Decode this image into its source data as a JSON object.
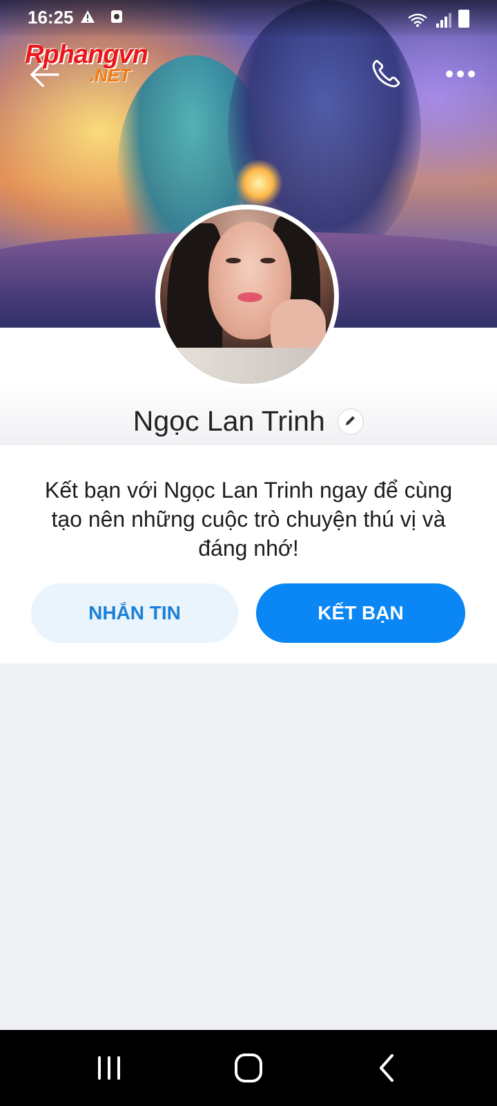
{
  "status_bar": {
    "time": "16:25",
    "left_icons": [
      "warning-icon",
      "media-icon"
    ],
    "right_icons": [
      "wifi-icon",
      "signal-icon",
      "battery-icon"
    ]
  },
  "watermark": {
    "brand": "Rphangvn",
    "suffix": ".NET"
  },
  "header": {
    "back_icon": "back-arrow-icon",
    "call_icon": "phone-icon",
    "more_icon": "more-dots-icon"
  },
  "profile": {
    "name": "Ngọc Lan Trinh",
    "edit_icon": "pencil-icon",
    "cover_image": "Aladdin and Jasmine on magic carpet",
    "avatar_image": "profile photo"
  },
  "invite": {
    "message": "Kết bạn với Ngọc Lan Trinh ngay để cùng tạo nên những cuộc trò chuyện thú vị và đáng nhớ!"
  },
  "actions": {
    "message_label": "NHẮN TIN",
    "add_friend_label": "KẾT BẠN"
  },
  "colors": {
    "accent": "#0a87f4",
    "secondary_bg": "#eaf4fc",
    "secondary_text": "#1b80d8",
    "page_bg": "#eff1f5"
  },
  "system_nav": {
    "recents_icon": "recents-icon",
    "home_icon": "home-icon",
    "back_icon": "system-back-icon"
  }
}
